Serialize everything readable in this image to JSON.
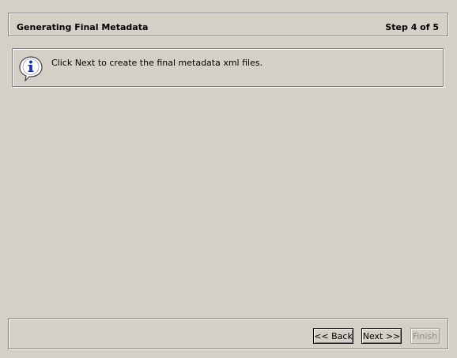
{
  "wizard": {
    "step_title": "Generating Final Metadata",
    "step_counter": "Step 4 of 5"
  },
  "info": {
    "icon": "info-icon",
    "message": "Click Next to create the final metadata xml files."
  },
  "buttons": {
    "back_label": "<< Back",
    "next_label": "Next >>",
    "finish_label": "Finish",
    "finish_enabled": false
  },
  "colors": {
    "window_background": "#d4d0c8",
    "icon_blue": "#1c2fa8",
    "disabled_text": "#8a8a8a"
  }
}
